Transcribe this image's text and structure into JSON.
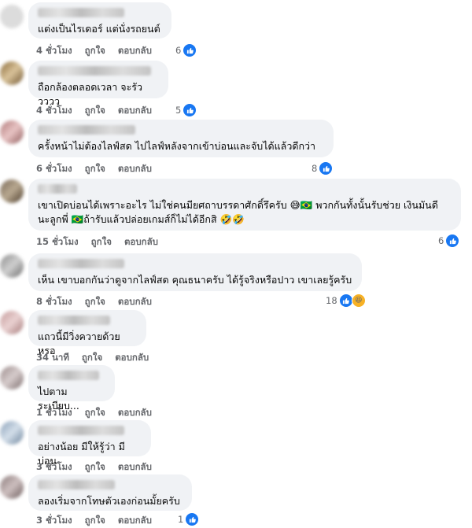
{
  "labels": {
    "like": "ถูกใจ",
    "reply": "ตอบกลับ"
  },
  "colors": {
    "bubble": "#f0f2f5",
    "meta": "#65676b",
    "like_blue": "#1877f2"
  },
  "comments": [
    {
      "text": "แต่งเป็นไรเดอร์ แต่นั่งรถยนต์",
      "time": "4 ชั่วโมง",
      "reaction_count": "6",
      "reactions": [
        "like"
      ]
    },
    {
      "text": "ถือกล้องตลอดเวลา จะรัววววว",
      "time": "4 ชั่วโมง",
      "reaction_count": "5",
      "reactions": [
        "like"
      ]
    },
    {
      "text": "ครั้งหน้าไม่ต้องไลฟ์สด ไปไลฟ์หลังจากเข้าบ่อนและจับได้แล้วดีกว่า",
      "time": "6 ชั่วโมง",
      "reaction_count": "8",
      "reactions": [
        "like"
      ]
    },
    {
      "text": "เขาเปิดบ่อนได้เพราะอะไร ไม่ใช่คนมียศถาบรรดาศักดิ์รึครับ 😅🇧🇷 พวกกันทั้งนั้นรับช่วย เงินมันดี\nนะลูกพี่ 🇧🇷ถ้ารับแล้วปล่อยเกมส์ก็ไม่ได้อีกสิ 🤣🤣",
      "time": "15 ชั่วโมง",
      "reaction_count": "6",
      "reactions": [
        "like"
      ]
    },
    {
      "text": "เห็น เขาบอกกันว่าดูจากไลฟ์สด คุณธนาครับ ได้รู้จริงหรือปาว เขาเลยรู้ครับ",
      "time": "8 ชั่วโมง",
      "reaction_count": "18",
      "reactions": [
        "like",
        "haha"
      ]
    },
    {
      "text": "แถวนี้มีวิ่งควายด้วยหรอ",
      "time": "34 นาที",
      "reaction_count": "",
      "reactions": []
    },
    {
      "text": "ไปตามระเบียบ...",
      "time": "1 ชั่วโมง",
      "reaction_count": "",
      "reactions": []
    },
    {
      "text": "อย่างน้อย มีให้รู้ว่า มีบ่อน",
      "time": "3 ชั่วโมง",
      "reaction_count": "",
      "reactions": []
    },
    {
      "text": "ลองเริ่มจากโทษตัวเองก่อนมั้ยครับ",
      "time": "3 ชั่วโมง",
      "reaction_count": "1",
      "reactions": [
        "like"
      ]
    }
  ]
}
